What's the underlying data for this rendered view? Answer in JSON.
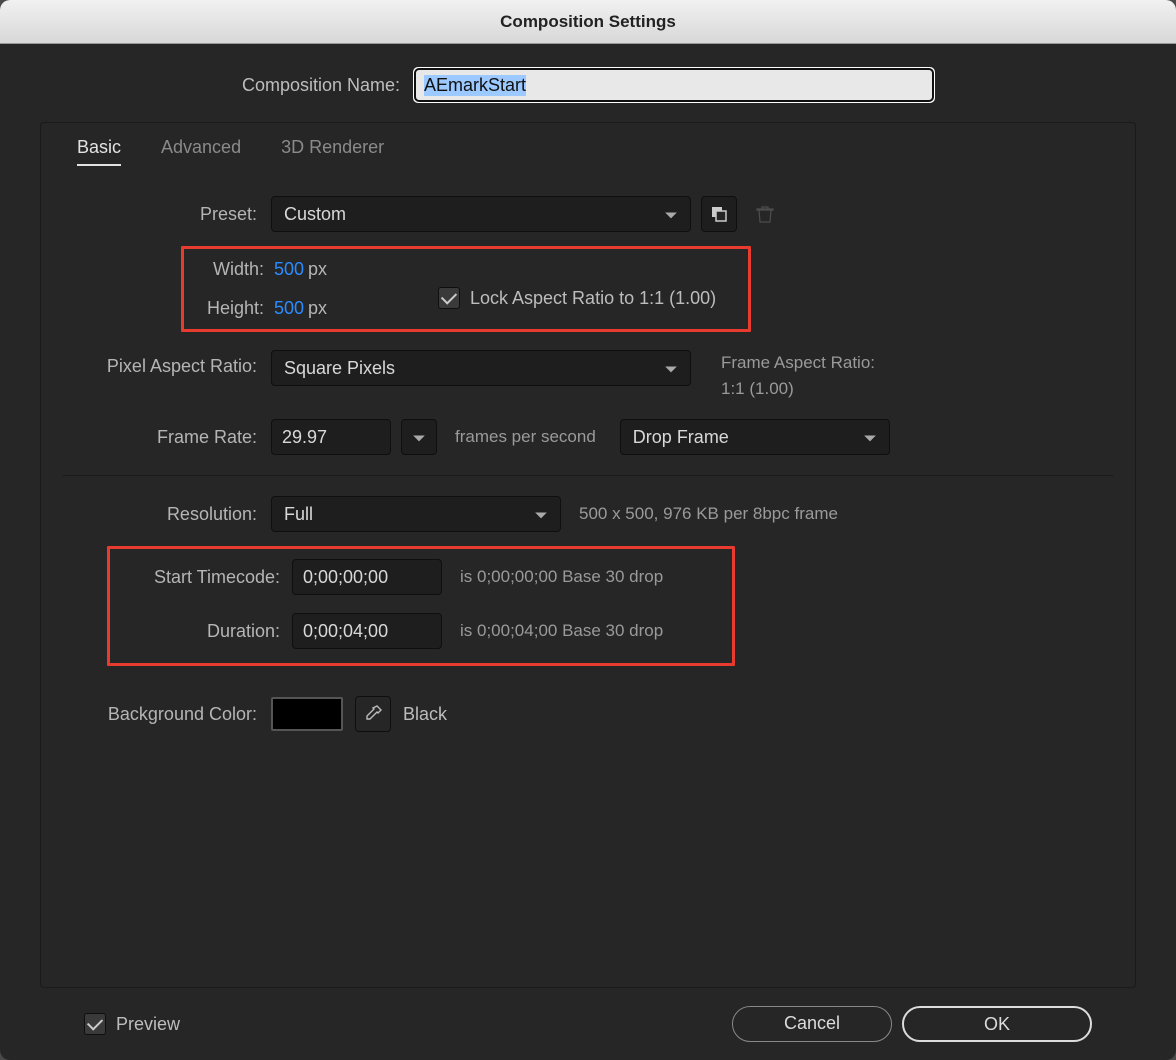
{
  "window": {
    "title": "Composition Settings"
  },
  "compName": {
    "label": "Composition Name:",
    "value": "AEmarkStart"
  },
  "tabs": {
    "basic": "Basic",
    "advanced": "Advanced",
    "renderer": "3D Renderer"
  },
  "preset": {
    "label": "Preset:",
    "value": "Custom"
  },
  "dims": {
    "widthLabel": "Width:",
    "widthVal": "500",
    "widthUnit": "px",
    "heightLabel": "Height:",
    "heightVal": "500",
    "heightUnit": "px",
    "lockLabel": "Lock Aspect Ratio to 1:1 (1.00)"
  },
  "par": {
    "label": "Pixel Aspect Ratio:",
    "value": "Square Pixels",
    "frameARLabel": "Frame Aspect Ratio:",
    "frameARVal": "1:1 (1.00)"
  },
  "frameRate": {
    "label": "Frame Rate:",
    "value": "29.97",
    "fps": "frames per second",
    "dropValue": "Drop Frame"
  },
  "resolution": {
    "label": "Resolution:",
    "value": "Full",
    "hint": "500 x 500, 976 KB per 8bpc frame"
  },
  "timecode": {
    "startLabel": "Start Timecode:",
    "startVal": "0;00;00;00",
    "startHint": "is 0;00;00;00  Base 30  drop",
    "durLabel": "Duration:",
    "durVal": "0;00;04;00",
    "durHint": "is 0;00;04;00  Base 30  drop"
  },
  "bg": {
    "label": "Background Color:",
    "name": "Black",
    "hex": "#000000"
  },
  "footer": {
    "preview": "Preview",
    "cancel": "Cancel",
    "ok": "OK"
  }
}
